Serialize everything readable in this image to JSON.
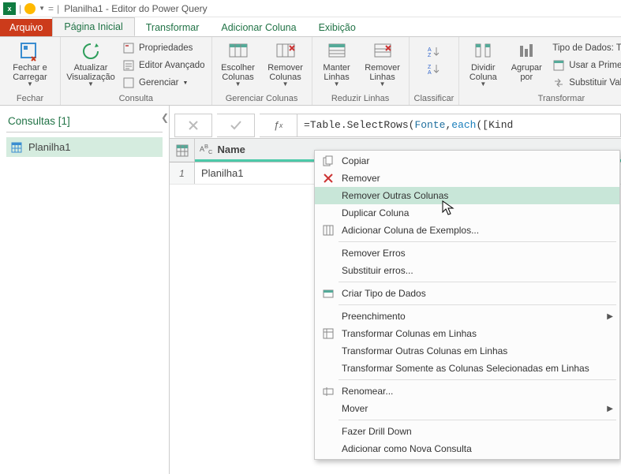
{
  "title": "Planilha1 - Editor do Power Query",
  "tabs": {
    "file": "Arquivo",
    "home": "Página Inicial",
    "transform": "Transformar",
    "addcol": "Adicionar Coluna",
    "view": "Exibição"
  },
  "ribbon": {
    "close_load": "Fechar e\nCarregar",
    "close_group": "Fechar",
    "refresh": "Atualizar\nVisualização",
    "properties": "Propriedades",
    "adv_editor": "Editor Avançado",
    "manage": "Gerenciar",
    "query_group": "Consulta",
    "choose_cols": "Escolher\nColunas",
    "remove_cols": "Remover\nColunas",
    "cols_group": "Gerenciar Colunas",
    "keep_rows": "Manter\nLinhas",
    "remove_rows": "Remover\nLinhas",
    "rows_group": "Reduzir Linhas",
    "sort_group": "Classificar",
    "split_col": "Dividir\nColuna",
    "group_by": "Agrupar\npor",
    "data_type": "Tipo de Dados: Tabela",
    "first_row_header": "Usar a Primeira Linha",
    "replace_vals": "Substituir Valores",
    "transform_group": "Transformar"
  },
  "queries": {
    "title": "Consultas [1]",
    "items": [
      "Planilha1"
    ]
  },
  "formula": {
    "prefix": "= ",
    "fn": "Table.SelectRows",
    "arg1": "Fonte",
    "kw": "each",
    "tail": "([Kind"
  },
  "grid": {
    "col_icon": "ABC",
    "col_name": "Name",
    "row1_num": "1",
    "row1_val": "Planilha1"
  },
  "menu": {
    "copy": "Copiar",
    "remove": "Remover",
    "remove_other": "Remover Outras Colunas",
    "duplicate": "Duplicar Coluna",
    "add_example": "Adicionar Coluna de Exemplos...",
    "remove_errors": "Remover Erros",
    "replace_errors": "Substituir erros...",
    "create_type": "Criar Tipo de Dados",
    "fill": "Preenchimento",
    "unpivot": "Transformar Colunas em Linhas",
    "unpivot_other": "Transformar Outras Colunas em Linhas",
    "unpivot_selected": "Transformar Somente as Colunas Selecionadas em Linhas",
    "rename": "Renomear...",
    "move": "Mover",
    "drill": "Fazer Drill Down",
    "new_query": "Adicionar como Nova Consulta"
  }
}
